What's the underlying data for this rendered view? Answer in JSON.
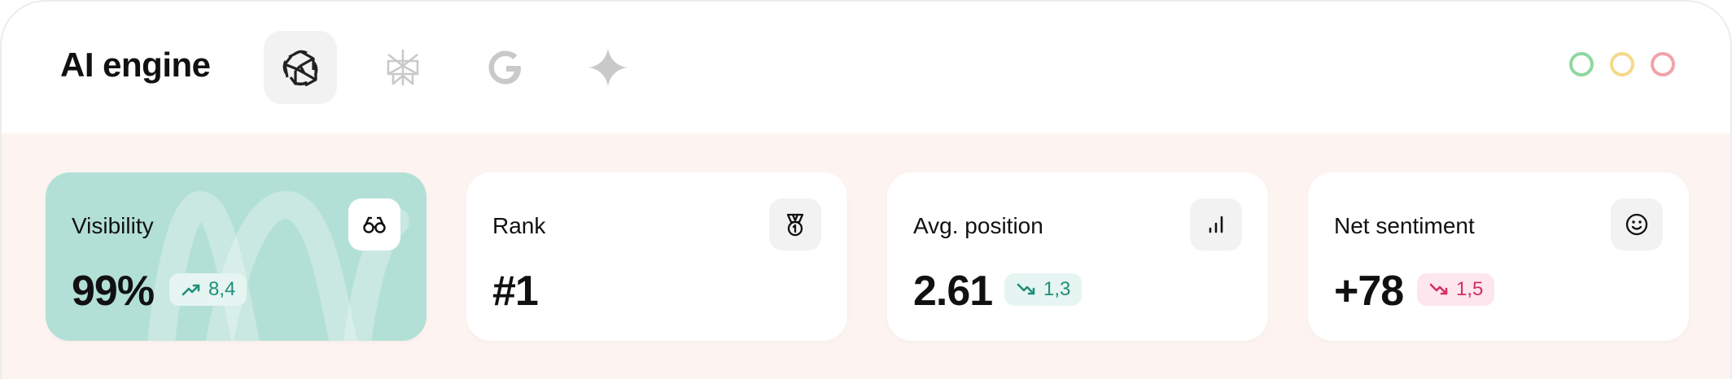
{
  "header": {
    "title": "AI engine",
    "engines": [
      {
        "icon": "openai-icon",
        "active": true
      },
      {
        "icon": "perplexity-icon",
        "active": false
      },
      {
        "icon": "google-icon",
        "active": false
      },
      {
        "icon": "gemini-icon",
        "active": false
      }
    ],
    "window_dots": [
      {
        "color": "#8fd8a0"
      },
      {
        "color": "#f5d98a"
      },
      {
        "color": "#f2a3a8"
      }
    ]
  },
  "metrics": [
    {
      "label": "Visibility",
      "value": "99%",
      "change": "8,4",
      "trend": "up",
      "icon": "glasses-icon"
    },
    {
      "label": "Rank",
      "value": "#1",
      "icon": "medal-icon"
    },
    {
      "label": "Avg. position",
      "value": "2.61",
      "change": "1,3",
      "trend": "down-good",
      "icon": "bar-chart-icon"
    },
    {
      "label": "Net sentiment",
      "value": "+78",
      "change": "1,5",
      "trend": "down-bad",
      "icon": "smiley-icon"
    }
  ],
  "colors": {
    "teal_card": "#b3e0d6",
    "content_bg": "#fdf4f1",
    "good": "#1f8f7a",
    "bad": "#d03060"
  }
}
